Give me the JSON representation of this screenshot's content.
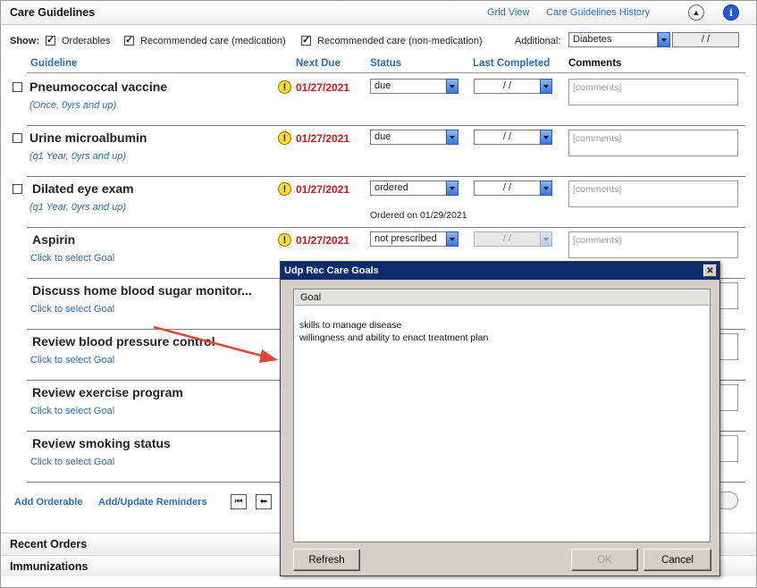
{
  "header": {
    "title": "Care Guidelines",
    "grid_view": "Grid View",
    "history": "Care Guidelines History",
    "collapse_glyph": "▲",
    "info_glyph": "i"
  },
  "show": {
    "label": "Show:",
    "orderables": "Orderables",
    "rec_med": "Recommended care (medication)",
    "rec_nonmed": "Recommended care (non-medication)",
    "additional_label": "Additional:",
    "additional_value": "Diabetes",
    "additional_date": "/ /"
  },
  "columns": {
    "guideline": "Guideline",
    "next_due": "Next Due",
    "status": "Status",
    "last_completed": "Last Completed",
    "comments": "Comments"
  },
  "rows": [
    {
      "title": "Pneumococcal vaccine",
      "sub": "(Once, 0yrs and up)",
      "due": "01/27/2021",
      "status": "due",
      "last": "/ /",
      "comment_placeholder": "[comments]"
    },
    {
      "title": "Urine microalbumin",
      "sub": "(q1 Year, 0yrs and up)",
      "due": "01/27/2021",
      "status": "due",
      "last": "/ /",
      "comment_placeholder": "[comments]"
    },
    {
      "title": "Dilated eye exam",
      "sub": "(q1 Year, 0yrs and up)",
      "due": "01/27/2021",
      "status": "ordered",
      "last": "/ /",
      "comment_placeholder": "[comments]",
      "note": "Ordered on 01/29/2021"
    },
    {
      "title": "Aspirin",
      "sub": "Click to select Goal",
      "due": "01/27/2021",
      "status": "not prescribed",
      "last": "/ /",
      "comment_placeholder": "[comments]"
    },
    {
      "title": "Discuss home blood sugar monitor...",
      "sub": "Click to select Goal"
    },
    {
      "title": "Review blood pressure control",
      "sub": "Click to select Goal"
    },
    {
      "title": "Review exercise program",
      "sub": "Click to select Goal"
    },
    {
      "title": "Review smoking status",
      "sub": "Click to select Goal"
    }
  ],
  "warn_glyph": "!",
  "footer": {
    "add_orderable": "Add Orderable",
    "add_update_reminders": "Add/Update Reminders",
    "first_glyph": "⏮",
    "prev_glyph": "⬅"
  },
  "sections": {
    "recent_orders": "Recent Orders",
    "immunizations": "Immunizations"
  },
  "dialog": {
    "title": "Udp Rec Care Goals",
    "close_glyph": "✕",
    "column": "Goal",
    "items": [
      "skills to manage disease",
      "willingness and ability to enact treatment plan"
    ],
    "refresh": "Refresh",
    "ok": "OK",
    "cancel": "Cancel"
  },
  "colors": {
    "link": "#2e6bc2",
    "due": "#d01818",
    "dialog_title": "#0c2c6e",
    "arrow": "#e0453c"
  }
}
